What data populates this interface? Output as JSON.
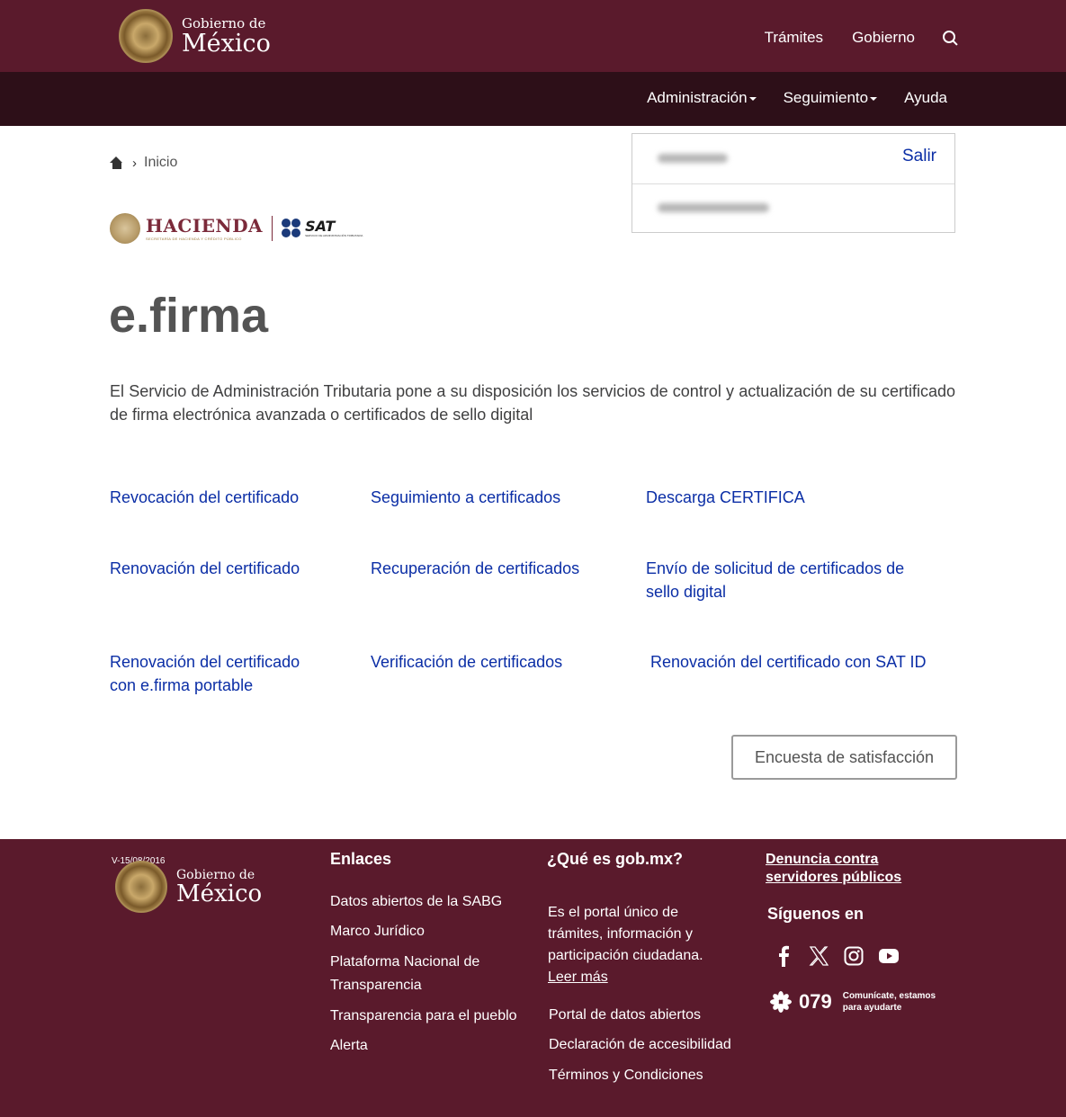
{
  "header": {
    "logo_small": "Gobierno de",
    "logo_big": "México",
    "nav": [
      "Trámites",
      "Gobierno"
    ],
    "subnav": [
      "Administración",
      "Seguimiento",
      "Ayuda"
    ]
  },
  "breadcrumb": {
    "label": "Inicio"
  },
  "userbox": {
    "logout": "Salir"
  },
  "brands": {
    "hacienda": "HACIENDA",
    "hacienda_sub": "SECRETARÍA DE HACIENDA Y CRÉDITO PÚBLICO",
    "sat": "SAT",
    "sat_sub": "SERVICIO DE ADMINISTRACIÓN TRIBUTARIA"
  },
  "main": {
    "title": "e.firma",
    "intro": "El Servicio de Administración Tributaria pone a su disposición los servicios de control y actualización de su certificado de firma electrónica avanzada o certificados de sello digital",
    "links": [
      "Revocación del certificado",
      "Seguimiento a certificados",
      "Descarga CERTIFICA",
      "Renovación del certificado",
      "Recuperación de certificados",
      "Envío de solicitud de certificados de sello digital",
      "Renovación del certificado con e.firma portable",
      "Verificación de certificados",
      "Renovación del certificado con SAT ID"
    ],
    "survey_button": "Encuesta de satisfacción"
  },
  "footer": {
    "version": "V-15/08/2016",
    "logo_small": "Gobierno de",
    "logo_big": "México",
    "enlaces_title": "Enlaces",
    "enlaces": [
      "Datos abiertos de la SABG",
      "Marco Jurídico",
      "Plataforma Nacional de Transparencia",
      "Transparencia para el pueblo",
      "Alerta"
    ],
    "que_es_title": "¿Qué es gob.mx?",
    "que_es_text": "Es el portal único de trámites, información y participación ciudadana.",
    "leer_mas": "Leer más",
    "que_es_links": [
      "Portal de datos abiertos",
      "Declaración de accesibilidad",
      "Términos y Condiciones"
    ],
    "denuncia": "Denuncia contra servidores públicos",
    "siguenos": "Síguenos en",
    "phone": "079",
    "phone_text": "Comunícate, estamos para ayudarte"
  },
  "colors": {
    "primary": "#5a1a2c",
    "dark": "#2d0f18",
    "link": "#0b2ea6"
  }
}
